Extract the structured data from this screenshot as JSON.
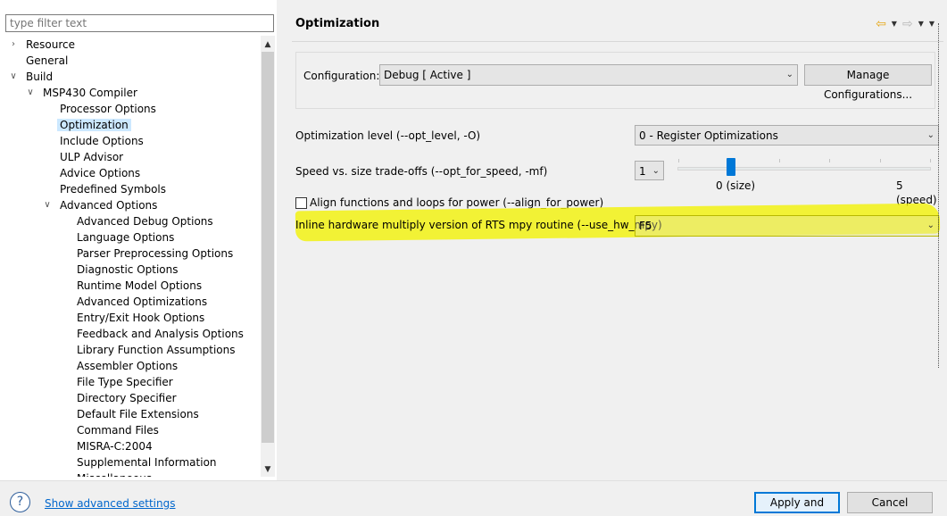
{
  "filter": {
    "placeholder": "type filter text"
  },
  "tree": {
    "items": [
      {
        "label": "Resource",
        "level": 0,
        "twisty": "collapsed"
      },
      {
        "label": "General",
        "level": 0,
        "twisty": "none"
      },
      {
        "label": "Build",
        "level": 0,
        "twisty": "expanded"
      },
      {
        "label": "MSP430 Compiler",
        "level": 1,
        "twisty": "expanded"
      },
      {
        "label": "Processor Options",
        "level": 2,
        "twisty": "none"
      },
      {
        "label": "Optimization",
        "level": 2,
        "twisty": "none",
        "selected": true
      },
      {
        "label": "Include Options",
        "level": 2,
        "twisty": "none"
      },
      {
        "label": "ULP Advisor",
        "level": 2,
        "twisty": "none"
      },
      {
        "label": "Advice Options",
        "level": 2,
        "twisty": "none"
      },
      {
        "label": "Predefined Symbols",
        "level": 2,
        "twisty": "none"
      },
      {
        "label": "Advanced Options",
        "level": 2,
        "twisty": "expanded"
      },
      {
        "label": "Advanced Debug Options",
        "level": 3,
        "twisty": "none"
      },
      {
        "label": "Language Options",
        "level": 3,
        "twisty": "none"
      },
      {
        "label": "Parser Preprocessing Options",
        "level": 3,
        "twisty": "none"
      },
      {
        "label": "Diagnostic Options",
        "level": 3,
        "twisty": "none"
      },
      {
        "label": "Runtime Model Options",
        "level": 3,
        "twisty": "none"
      },
      {
        "label": "Advanced Optimizations",
        "level": 3,
        "twisty": "none"
      },
      {
        "label": "Entry/Exit Hook Options",
        "level": 3,
        "twisty": "none"
      },
      {
        "label": "Feedback and Analysis Options",
        "level": 3,
        "twisty": "none"
      },
      {
        "label": "Library Function Assumptions",
        "level": 3,
        "twisty": "none"
      },
      {
        "label": "Assembler Options",
        "level": 3,
        "twisty": "none"
      },
      {
        "label": "File Type Specifier",
        "level": 3,
        "twisty": "none"
      },
      {
        "label": "Directory Specifier",
        "level": 3,
        "twisty": "none"
      },
      {
        "label": "Default File Extensions",
        "level": 3,
        "twisty": "none"
      },
      {
        "label": "Command Files",
        "level": 3,
        "twisty": "none"
      },
      {
        "label": "MISRA-C:2004",
        "level": 3,
        "twisty": "none"
      },
      {
        "label": "Supplemental Information",
        "level": 3,
        "twisty": "none"
      },
      {
        "label": "Miscellaneous",
        "level": 3,
        "twisty": "none"
      }
    ]
  },
  "page": {
    "title": "Optimization"
  },
  "config": {
    "label": "Configuration:",
    "value": "Debug  [ Active ]",
    "manage_label": "Manage Configurations..."
  },
  "opt_level": {
    "label": "Optimization level (--opt_level, -O)",
    "value": "0 - Register Optimizations"
  },
  "speed": {
    "label": "Speed vs. size trade-offs (--opt_for_speed, -mf)",
    "value": "1",
    "slider_min_label": "0 (size)",
    "slider_max_label": "5 (speed)",
    "slider_min": 0,
    "slider_max": 5,
    "slider_value": 1
  },
  "align": {
    "label": "Align functions and loops for power (--align_for_power)",
    "checked": false
  },
  "hw_mpy": {
    "label": "Inline hardware multiply version of RTS mpy routine (--use_hw_mpy)",
    "value": "F5"
  },
  "footer": {
    "help_label": "?",
    "advanced_link": "Show advanced settings",
    "apply_label": "Apply and Close",
    "cancel_label": "Cancel"
  },
  "colors": {
    "highlight": "#f2f200",
    "selection": "#cce8ff",
    "slider_thumb": "#0078d7",
    "link": "#0066cc"
  }
}
